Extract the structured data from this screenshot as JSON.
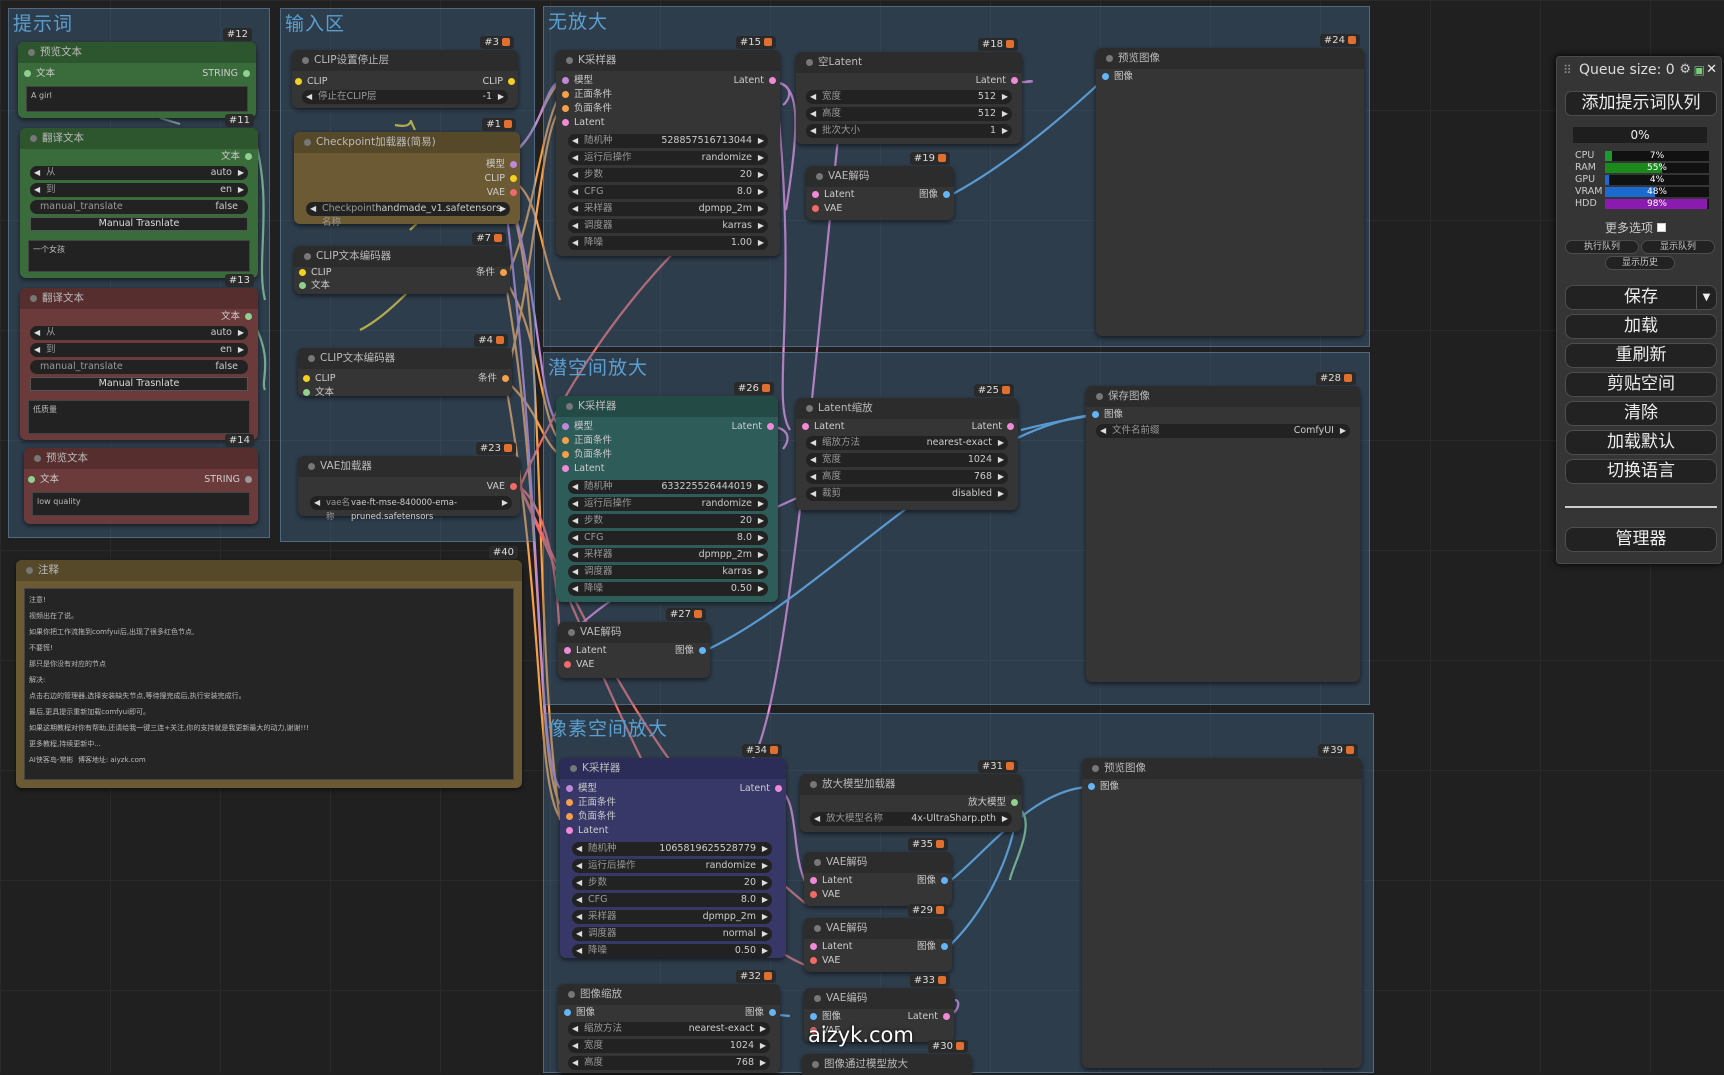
{
  "groups": {
    "prompt": "提示词",
    "input": "输入区",
    "no_upscale": "无放大",
    "latent_upscale": "潜空间放大",
    "pixel_upscale": "像素空间放大"
  },
  "nodes": {
    "n12": {
      "id": "#12",
      "title": "预览文本",
      "in_text": "文本",
      "out_string": "STRING",
      "text": "A girl"
    },
    "n11": {
      "id": "#11",
      "title": "翻译文本",
      "out_text": "文本",
      "from_label": "从",
      "from_val": "auto",
      "to_label": "到",
      "to_val": "en",
      "manual_label": "manual_translate",
      "manual_val": "false",
      "button": "Manual Trasnlate",
      "text": "一个女孩"
    },
    "n13": {
      "id": "#13",
      "title": "翻译文本",
      "out_text": "文本",
      "from_label": "从",
      "from_val": "auto",
      "to_label": "到",
      "to_val": "en",
      "manual_label": "manual_translate",
      "manual_val": "false",
      "button": "Manual Trasnlate",
      "text": "低质量"
    },
    "n14": {
      "id": "#14",
      "title": "预览文本",
      "in_text": "文本",
      "out_string": "STRING",
      "text": "low quality"
    },
    "n3": {
      "id": "#3",
      "title": "CLIP设置停止层",
      "in_clip": "CLIP",
      "out_clip": "CLIP",
      "w_label": "停止在CLIP层",
      "w_val": "-1"
    },
    "n1": {
      "id": "#1",
      "title": "Checkpoint加载器(简易)",
      "out_model": "模型",
      "out_clip": "CLIP",
      "out_vae": "VAE",
      "w_label": "Checkpoint名称",
      "w_val": "handmade_v1.safetensors"
    },
    "n7": {
      "id": "#7",
      "title": "CLIP文本编码器",
      "in_clip": "CLIP",
      "in_text": "文本",
      "out_cond": "条件"
    },
    "n4": {
      "id": "#4",
      "title": "CLIP文本编码器",
      "in_clip": "CLIP",
      "in_text": "文本",
      "out_cond": "条件"
    },
    "n23": {
      "id": "#23",
      "title": "VAE加载器",
      "out_vae": "VAE",
      "w_label": "vae名称",
      "w_val": "vae-ft-mse-840000-ema-pruned.safetensors"
    },
    "n40": {
      "id": "#40",
      "title": "注释",
      "lines": [
        "注意!",
        "视频出在了说。",
        "如果你把工作流拖到comfyui后,出现了很多红色节点,",
        "不要慌!",
        "那只是你没有对应的节点",
        "解决:",
        "点击右边的管理器,选择安装缺失节点,等待搜完成后,执行安装完成行。",
        "最后,更具提示重新加载comfyui即可。",
        "如果这期教程对你有帮助,还请给我一键三连+关注,你的支持就是我更新最大的动力,谢谢!!!",
        "更多教程,持续更新中...",
        "AI侠客岛-常彬  博客地址: aiyzk.com"
      ]
    },
    "n15": {
      "id": "#15",
      "title": "K采样器",
      "inputs": [
        "模型",
        "正面条件",
        "负面条件",
        "Latent"
      ],
      "out": "Latent",
      "widgets": [
        [
          "随机种",
          "528857516713044"
        ],
        [
          "运行后操作",
          "randomize"
        ],
        [
          "步数",
          "20"
        ],
        [
          "CFG",
          "8.0"
        ],
        [
          "采样器",
          "dpmpp_2m"
        ],
        [
          "调度器",
          "karras"
        ],
        [
          "降噪",
          "1.00"
        ]
      ]
    },
    "n18": {
      "id": "#18",
      "title": "空Latent",
      "out": "Latent",
      "widgets": [
        [
          "宽度",
          "512"
        ],
        [
          "高度",
          "512"
        ],
        [
          "批次大小",
          "1"
        ]
      ]
    },
    "n19": {
      "id": "#19",
      "title": "VAE解码",
      "inputs": [
        "Latent",
        "VAE"
      ],
      "out": "图像"
    },
    "n24": {
      "id": "#24",
      "title": "预览图像",
      "in": "图像"
    },
    "n26": {
      "id": "#26",
      "title": "K采样器",
      "inputs": [
        "模型",
        "正面条件",
        "负面条件",
        "Latent"
      ],
      "out": "Latent",
      "widgets": [
        [
          "随机种",
          "633225526444019"
        ],
        [
          "运行后操作",
          "randomize"
        ],
        [
          "步数",
          "20"
        ],
        [
          "CFG",
          "8.0"
        ],
        [
          "采样器",
          "dpmpp_2m"
        ],
        [
          "调度器",
          "karras"
        ],
        [
          "降噪",
          "0.50"
        ]
      ]
    },
    "n25": {
      "id": "#25",
      "title": "Latent缩放",
      "in": "Latent",
      "out": "Latent",
      "widgets": [
        [
          "缩放方法",
          "nearest-exact"
        ],
        [
          "宽度",
          "1024"
        ],
        [
          "高度",
          "768"
        ],
        [
          "裁剪",
          "disabled"
        ]
      ]
    },
    "n28": {
      "id": "#28",
      "title": "保存图像",
      "in": "图像",
      "w_label": "文件名前缀",
      "w_val": "ComfyUI"
    },
    "n27": {
      "id": "#27",
      "title": "VAE解码",
      "inputs": [
        "Latent",
        "VAE"
      ],
      "out": "图像"
    },
    "n34": {
      "id": "#34",
      "title": "K采样器",
      "inputs": [
        "模型",
        "正面条件",
        "负面条件",
        "Latent"
      ],
      "out": "Latent",
      "widgets": [
        [
          "随机种",
          "1065819625528779"
        ],
        [
          "运行后操作",
          "randomize"
        ],
        [
          "步数",
          "20"
        ],
        [
          "CFG",
          "8.0"
        ],
        [
          "采样器",
          "dpmpp_2m"
        ],
        [
          "调度器",
          "normal"
        ],
        [
          "降噪",
          "0.50"
        ]
      ]
    },
    "n31": {
      "id": "#31",
      "title": "放大模型加载器",
      "out": "放大模型",
      "w_label": "放大模型名称",
      "w_val": "4x-UltraSharp.pth"
    },
    "n35": {
      "id": "#35",
      "title": "VAE解码",
      "inputs": [
        "Latent",
        "VAE"
      ],
      "out": "图像"
    },
    "n29": {
      "id": "#29",
      "title": "VAE解码",
      "inputs": [
        "Latent",
        "VAE"
      ],
      "out": "图像"
    },
    "n39": {
      "id": "#39",
      "title": "预览图像",
      "in": "图像"
    },
    "n32": {
      "id": "#32",
      "title": "图像缩放",
      "in": "图像",
      "out": "图像",
      "widgets": [
        [
          "缩放方法",
          "nearest-exact"
        ],
        [
          "宽度",
          "1024"
        ],
        [
          "高度",
          "768"
        ]
      ]
    },
    "n33": {
      "id": "#33",
      "title": "VAE编码",
      "inputs": [
        "图像",
        "VAE"
      ],
      "out": "Latent"
    },
    "n30": {
      "id": "#30",
      "title": "图像通过模型放大"
    }
  },
  "panel": {
    "queue_label": "Queue size: 0",
    "add_queue": "添加提示词队列",
    "progress": "0%",
    "stats": [
      {
        "label": "CPU",
        "value": "7%",
        "pct": 7,
        "color": "#1a9a2a"
      },
      {
        "label": "RAM",
        "value": "55%",
        "pct": 55,
        "color": "#1a8a1a"
      },
      {
        "label": "GPU",
        "value": "4%",
        "pct": 4,
        "color": "#1a6ad0"
      },
      {
        "label": "VRAM",
        "value": "48%",
        "pct": 48,
        "color": "#1a6ad0"
      },
      {
        "label": "HDD",
        "value": "98%",
        "pct": 98,
        "color": "#8a1ab0"
      }
    ],
    "more_options": "更多选项",
    "exec_queue": "执行队列",
    "show_queue": "显示队列",
    "show_history": "显示历史",
    "save": "保存",
    "load": "加载",
    "refresh": "重刷新",
    "clipspace": "剪贴空间",
    "clear": "清除",
    "load_default": "加载默认",
    "switch_lang": "切换语言",
    "manager": "管理器"
  },
  "watermark": "aizyk.com"
}
